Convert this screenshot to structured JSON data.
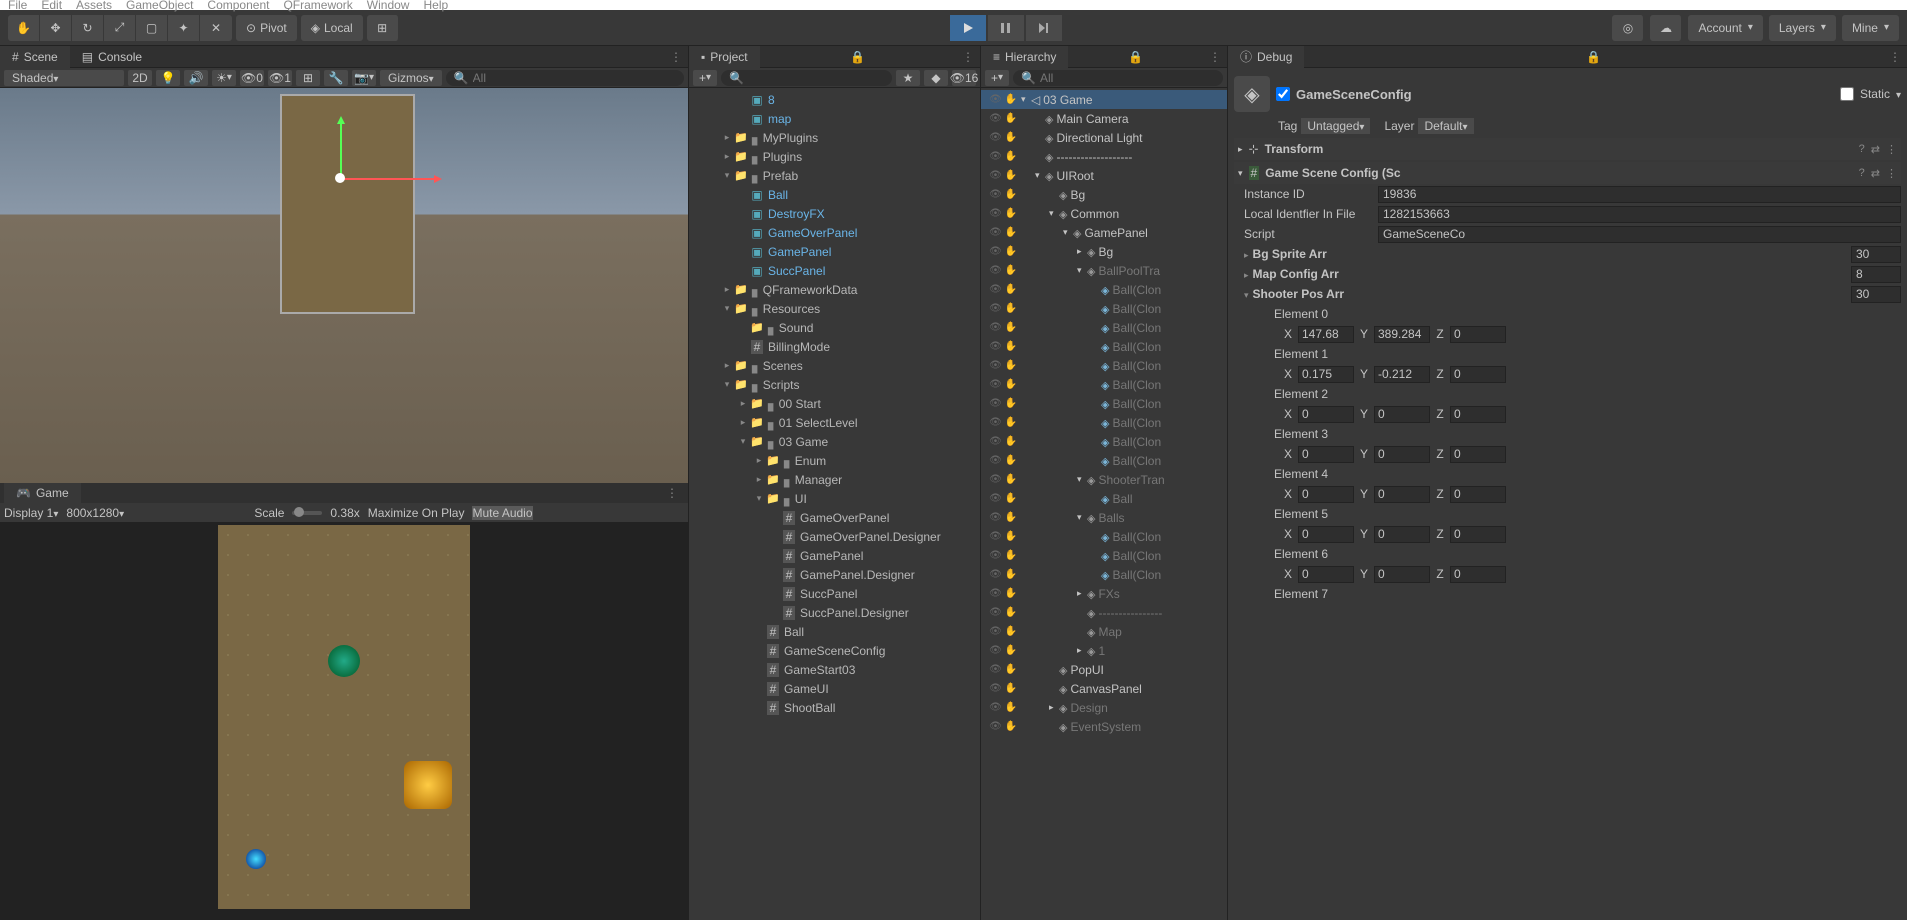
{
  "menu": [
    "File",
    "Edit",
    "Assets",
    "GameObject",
    "Component",
    "QFramework",
    "Window",
    "Help"
  ],
  "toolbar": {
    "pivot": "Pivot",
    "local": "Local",
    "account": "Account",
    "layers": "Layers",
    "layout": "Mine"
  },
  "scene": {
    "tab": "Scene",
    "console": "Console",
    "shading": "Shaded",
    "twod": "2D",
    "gizmos": "Gizmos",
    "search": "All"
  },
  "game": {
    "tab": "Game",
    "display": "Display 1",
    "res": "800x1280",
    "scale_lbl": "Scale",
    "scale": "0.38x",
    "maxplay": "Maximize On Play",
    "mute": "Mute Audio"
  },
  "project": {
    "tab": "Project",
    "search": "",
    "count": "16",
    "items": [
      {
        "d": 3,
        "i": "prefab",
        "t": "8"
      },
      {
        "d": 3,
        "i": "prefab",
        "t": "map"
      },
      {
        "d": 2,
        "a": "r",
        "i": "folder",
        "t": "MyPlugins"
      },
      {
        "d": 2,
        "a": "r",
        "i": "folder",
        "t": "Plugins"
      },
      {
        "d": 2,
        "a": "d",
        "i": "folder",
        "t": "Prefab"
      },
      {
        "d": 3,
        "i": "prefab",
        "t": "Ball"
      },
      {
        "d": 3,
        "i": "prefab",
        "t": "DestroyFX"
      },
      {
        "d": 3,
        "i": "prefab",
        "t": "GameOverPanel"
      },
      {
        "d": 3,
        "i": "prefab",
        "t": "GamePanel"
      },
      {
        "d": 3,
        "i": "prefab",
        "t": "SuccPanel"
      },
      {
        "d": 2,
        "a": "r",
        "i": "folder",
        "t": "QFrameworkData"
      },
      {
        "d": 2,
        "a": "d",
        "i": "folder",
        "t": "Resources"
      },
      {
        "d": 3,
        "i": "folder",
        "t": "Sound"
      },
      {
        "d": 3,
        "i": "script",
        "t": "BillingMode"
      },
      {
        "d": 2,
        "a": "r",
        "i": "folder",
        "t": "Scenes"
      },
      {
        "d": 2,
        "a": "d",
        "i": "folder",
        "t": "Scripts"
      },
      {
        "d": 3,
        "a": "r",
        "i": "folder",
        "t": "00 Start"
      },
      {
        "d": 3,
        "a": "r",
        "i": "folder",
        "t": "01 SelectLevel"
      },
      {
        "d": 3,
        "a": "d",
        "i": "folder",
        "t": "03 Game"
      },
      {
        "d": 4,
        "a": "r",
        "i": "folder",
        "t": "Enum"
      },
      {
        "d": 4,
        "a": "r",
        "i": "folder",
        "t": "Manager"
      },
      {
        "d": 4,
        "a": "d",
        "i": "folder",
        "t": "UI"
      },
      {
        "d": 5,
        "i": "script",
        "t": "GameOverPanel"
      },
      {
        "d": 5,
        "i": "script",
        "t": "GameOverPanel.Designer"
      },
      {
        "d": 5,
        "i": "script",
        "t": "GamePanel"
      },
      {
        "d": 5,
        "i": "script",
        "t": "GamePanel.Designer"
      },
      {
        "d": 5,
        "i": "script",
        "t": "SuccPanel"
      },
      {
        "d": 5,
        "i": "script",
        "t": "SuccPanel.Designer"
      },
      {
        "d": 4,
        "i": "script",
        "t": "Ball"
      },
      {
        "d": 4,
        "i": "script",
        "t": "GameSceneConfig"
      },
      {
        "d": 4,
        "i": "script",
        "t": "GameStart03"
      },
      {
        "d": 4,
        "i": "script",
        "t": "GameUI"
      },
      {
        "d": 4,
        "i": "script",
        "t": "ShootBall"
      }
    ]
  },
  "hierarchy": {
    "tab": "Hierarchy",
    "search": "All",
    "items": [
      {
        "d": 0,
        "a": "d",
        "i": "scene",
        "t": "03 Game",
        "sel": true
      },
      {
        "d": 1,
        "i": "cube",
        "t": "Main Camera"
      },
      {
        "d": 1,
        "i": "cube",
        "t": "Directional Light"
      },
      {
        "d": 1,
        "i": "cube",
        "t": "-------------------"
      },
      {
        "d": 1,
        "a": "d",
        "i": "cube",
        "t": "UIRoot"
      },
      {
        "d": 2,
        "i": "cube",
        "t": "Bg"
      },
      {
        "d": 2,
        "a": "d",
        "i": "cube",
        "t": "Common"
      },
      {
        "d": 3,
        "a": "d",
        "i": "cube",
        "t": "GamePanel"
      },
      {
        "d": 4,
        "a": "r",
        "i": "cube",
        "t": "Bg"
      },
      {
        "d": 4,
        "a": "d",
        "i": "cube",
        "t": "BallPoolTra",
        "f": true
      },
      {
        "d": 5,
        "i": "cubep",
        "t": "Ball(Clon",
        "f": true
      },
      {
        "d": 5,
        "i": "cubep",
        "t": "Ball(Clon",
        "f": true
      },
      {
        "d": 5,
        "i": "cubep",
        "t": "Ball(Clon",
        "f": true
      },
      {
        "d": 5,
        "i": "cubep",
        "t": "Ball(Clon",
        "f": true
      },
      {
        "d": 5,
        "i": "cubep",
        "t": "Ball(Clon",
        "f": true
      },
      {
        "d": 5,
        "i": "cubep",
        "t": "Ball(Clon",
        "f": true
      },
      {
        "d": 5,
        "i": "cubep",
        "t": "Ball(Clon",
        "f": true
      },
      {
        "d": 5,
        "i": "cubep",
        "t": "Ball(Clon",
        "f": true
      },
      {
        "d": 5,
        "i": "cubep",
        "t": "Ball(Clon",
        "f": true
      },
      {
        "d": 5,
        "i": "cubep",
        "t": "Ball(Clon",
        "f": true
      },
      {
        "d": 4,
        "a": "d",
        "i": "cube",
        "t": "ShooterTran",
        "f": true
      },
      {
        "d": 5,
        "i": "cubep",
        "t": "Ball",
        "f": true
      },
      {
        "d": 4,
        "a": "d",
        "i": "cube",
        "t": "Balls",
        "f": true
      },
      {
        "d": 5,
        "i": "cubep",
        "t": "Ball(Clon",
        "f": true
      },
      {
        "d": 5,
        "i": "cubep",
        "t": "Ball(Clon",
        "f": true
      },
      {
        "d": 5,
        "i": "cubep",
        "t": "Ball(Clon",
        "f": true
      },
      {
        "d": 4,
        "a": "r",
        "i": "cube",
        "t": "FXs",
        "f": true
      },
      {
        "d": 4,
        "i": "cube",
        "t": "----------------",
        "f": true
      },
      {
        "d": 4,
        "i": "cube",
        "t": "Map",
        "f": true
      },
      {
        "d": 4,
        "a": "r",
        "i": "cube",
        "t": "1",
        "f": true
      },
      {
        "d": 2,
        "i": "cube",
        "t": "PopUI"
      },
      {
        "d": 2,
        "i": "cube",
        "t": "CanvasPanel"
      },
      {
        "d": 2,
        "a": "r",
        "i": "cube",
        "t": "Design",
        "f": true
      },
      {
        "d": 2,
        "i": "cube",
        "t": "EventSystem",
        "f": true
      }
    ]
  },
  "inspector": {
    "tab": "Debug",
    "name": "GameSceneConfig",
    "static": "Static",
    "tag_lbl": "Tag",
    "tag": "Untagged",
    "layer_lbl": "Layer",
    "layer": "Default",
    "transform": "Transform",
    "comp": "Game Scene Config (Sc",
    "rows": [
      {
        "l": "Instance ID",
        "v": "19836"
      },
      {
        "l": "Local Identfier In File",
        "v": "1282153663"
      },
      {
        "l": "Script",
        "v": "GameSceneCo"
      }
    ],
    "arrs": [
      {
        "l": "Bg Sprite Arr",
        "v": "30"
      },
      {
        "l": "Map Config Arr",
        "v": "8"
      },
      {
        "l": "Shooter Pos Arr",
        "v": "30"
      }
    ],
    "elems": [
      {
        "n": "Element 0",
        "x": "147.68",
        "y": "389.284",
        "z": "0"
      },
      {
        "n": "Element 1",
        "x": "0.175",
        "y": "-0.212",
        "z": "0"
      },
      {
        "n": "Element 2",
        "x": "0",
        "y": "0",
        "z": "0"
      },
      {
        "n": "Element 3",
        "x": "0",
        "y": "0",
        "z": "0"
      },
      {
        "n": "Element 4",
        "x": "0",
        "y": "0",
        "z": "0"
      },
      {
        "n": "Element 5",
        "x": "0",
        "y": "0",
        "z": "0"
      },
      {
        "n": "Element 6",
        "x": "0",
        "y": "0",
        "z": "0"
      },
      {
        "n": "Element 7",
        "x": "",
        "y": "",
        "z": ""
      }
    ]
  }
}
